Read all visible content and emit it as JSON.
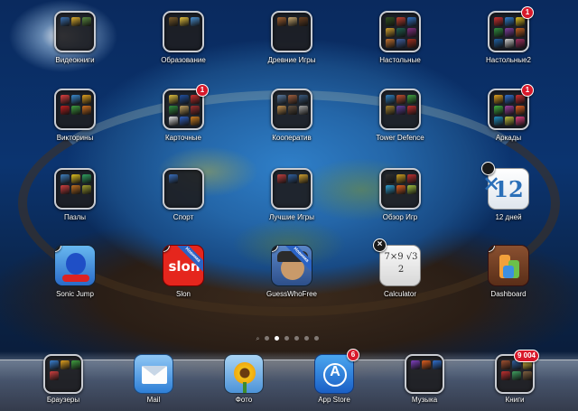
{
  "screen": {
    "page_dots": {
      "count": 6,
      "active_index": 1
    }
  },
  "folders": [
    {
      "id": "videobooks",
      "label": "Видеокниги",
      "badge": "",
      "minis": [
        "#3a6fb0",
        "#e0b030",
        "#5a8a40"
      ]
    },
    {
      "id": "education",
      "label": "Образование",
      "badge": "",
      "minis": [
        "#7a5c2a",
        "#e4c040",
        "#4a90d0"
      ]
    },
    {
      "id": "ancient-games",
      "label": "Древние Игры",
      "badge": "",
      "minis": [
        "#a06030",
        "#c8a870",
        "#6a4020"
      ]
    },
    {
      "id": "board-games",
      "label": "Настольные",
      "badge": "",
      "minis": [
        "#305020",
        "#c04030",
        "#3070c0",
        "#d0a030",
        "#206050",
        "#803080",
        "#c07030",
        "#4060a0",
        "#a03020"
      ]
    },
    {
      "id": "board-games-2",
      "label": "Настольные2",
      "badge": "1",
      "minis": [
        "#d03030",
        "#3080d0",
        "#e0c020",
        "#309040",
        "#8040a0",
        "#c06020",
        "#2060a0",
        "#d0d0d0",
        "#a03060"
      ]
    },
    {
      "id": "quizzes",
      "label": "Викторины",
      "badge": "",
      "minis": [
        "#e04040",
        "#3a8ad0",
        "#e0a020",
        "#c02020",
        "#40a040",
        "#d07020"
      ]
    },
    {
      "id": "card-games",
      "label": "Карточные",
      "badge": "1",
      "minis": [
        "#e0c040",
        "#2050a0",
        "#d03030",
        "#309040",
        "#c0a060",
        "#a03030",
        "#e0e0e0",
        "#3060c0",
        "#d08020"
      ]
    },
    {
      "id": "coop",
      "label": "Кооператив",
      "badge": "",
      "minis": [
        "#5a7aa0",
        "#a06040",
        "#3a5a80",
        "#c09050",
        "#605040",
        "#a0a0a0"
      ]
    },
    {
      "id": "tower-defence",
      "label": "Tower Defence",
      "badge": "",
      "minis": [
        "#3080c0",
        "#c05030",
        "#40a040",
        "#a08030",
        "#6040a0",
        "#c03030"
      ]
    },
    {
      "id": "arcades",
      "label": "Аркады",
      "badge": "1",
      "minis": [
        "#e0a020",
        "#3070d0",
        "#d03030",
        "#40b040",
        "#a040a0",
        "#e06020",
        "#2090c0",
        "#c0c040",
        "#e04080"
      ]
    },
    {
      "id": "puzzles",
      "label": "Пазлы",
      "badge": "",
      "minis": [
        "#4080c0",
        "#e0c020",
        "#30a060",
        "#d04040",
        "#c07020",
        "#a0a030"
      ]
    },
    {
      "id": "sport",
      "label": "Спорт",
      "badge": "",
      "minis": [
        "#3a70c0"
      ]
    },
    {
      "id": "best-games",
      "label": "Лучшие Игры",
      "badge": "",
      "minis": [
        "#c04040",
        "#3060a0",
        "#d0a030"
      ]
    },
    {
      "id": "games-review",
      "label": "Обзор Игр",
      "badge": "",
      "minis": [
        "#303030",
        "#d0a020",
        "#c03030",
        "#30a0d0",
        "#e06020",
        "#a0c040"
      ]
    }
  ],
  "apps": [
    {
      "id": "12-days",
      "label": "12 дней",
      "icon": "calendar-12-icon",
      "tile_text": "12",
      "deletable": true
    },
    {
      "id": "sonic-jump",
      "label": "Sonic Jump",
      "icon": "sonic-hedgehog-icon",
      "deletable": true
    },
    {
      "id": "slon",
      "label": "Slon",
      "icon": "slon-logo-icon",
      "tile_text": "slon",
      "ribbon": "Новинка",
      "deletable": true
    },
    {
      "id": "guesswhofree",
      "label": "GuessWhoFree",
      "icon": "face-with-hat-icon",
      "ribbon": "Новинка",
      "deletable": true
    },
    {
      "id": "calculator",
      "label": "Calculator",
      "icon": "handwritten-math-icon",
      "tile_text": "7×9 √3 2",
      "deletable": true
    },
    {
      "id": "dashboard",
      "label": "Dashboard",
      "icon": "color-bars-icon",
      "deletable": true
    }
  ],
  "dock": [
    {
      "id": "browsers",
      "label": "Браузеры",
      "type": "folder",
      "badge": "",
      "minis": [
        "#3a80d0",
        "#e0a020",
        "#40a040",
        "#d04040"
      ]
    },
    {
      "id": "mail",
      "label": "Mail",
      "type": "app",
      "icon": "envelope-icon",
      "badge": ""
    },
    {
      "id": "photos",
      "label": "Фото",
      "type": "app",
      "icon": "sunflower-icon",
      "badge": ""
    },
    {
      "id": "app-store",
      "label": "App Store",
      "type": "app",
      "icon": "app-store-icon",
      "badge": "6"
    },
    {
      "id": "music",
      "label": "Музыка",
      "type": "folder",
      "badge": "",
      "minis": [
        "#8040c0",
        "#e06020",
        "#3070d0"
      ]
    },
    {
      "id": "books",
      "label": "Книги",
      "type": "folder",
      "badge": "9 004",
      "minis": [
        "#a05030",
        "#3060a0",
        "#e0c040",
        "#c03030",
        "#40a060",
        "#806040"
      ]
    }
  ]
}
